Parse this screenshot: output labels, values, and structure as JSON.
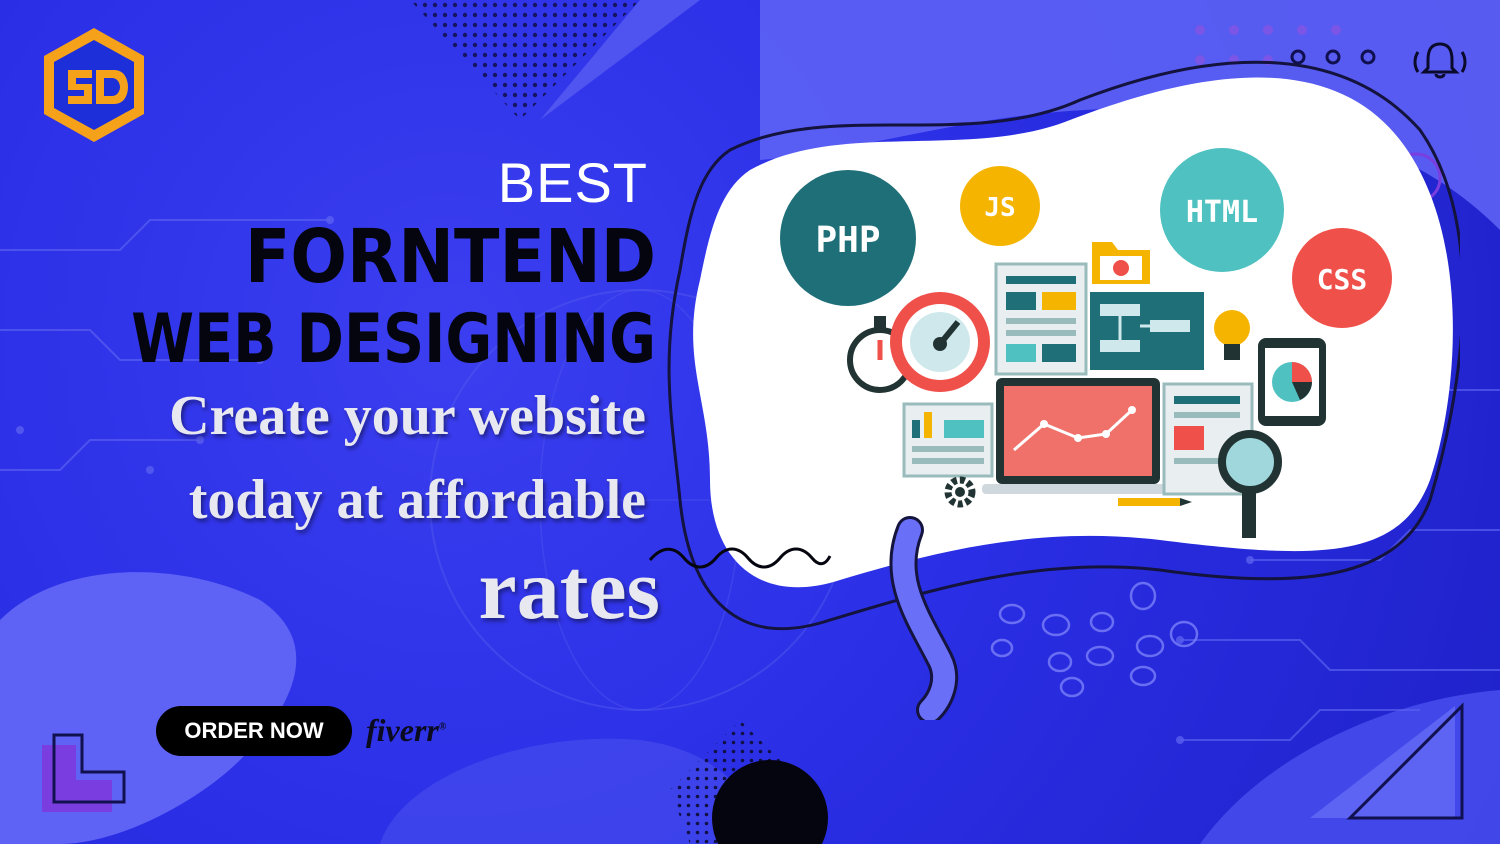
{
  "banner": {
    "kicker": "BEST",
    "headline_line1": "FORNTEND",
    "headline_line2": "WEB DESIGNING",
    "tagline_line1": "Create your website",
    "tagline_line2": "today at affordable",
    "tagline_line3": "rates"
  },
  "cta": {
    "order_label": "ORDER NOW"
  },
  "brand": {
    "marketplace": "fiverr",
    "registered_mark": "®"
  },
  "illustration": {
    "bubbles": [
      {
        "label": "PHP",
        "color": "#1f6f78"
      },
      {
        "label": "JS",
        "color": "#f5b400"
      },
      {
        "label": "HTML",
        "color": "#4fc1c0"
      },
      {
        "label": "CSS",
        "color": "#f0504a"
      }
    ],
    "icons": [
      "stopwatch-icon",
      "gauge-icon",
      "folder-icon",
      "document-icon",
      "flowchart-icon",
      "lightbulb-icon",
      "tablet-pie-chart-icon",
      "laptop-chart-icon",
      "magnifier-icon",
      "gear-icon",
      "pencil-icon"
    ]
  },
  "colors": {
    "background": "#2b2fe6",
    "background_light": "#5e63f5",
    "bubble_fill": "#ffffff",
    "logo_orange": "#f5a21a",
    "logo_blue": "#1c2fd8"
  }
}
